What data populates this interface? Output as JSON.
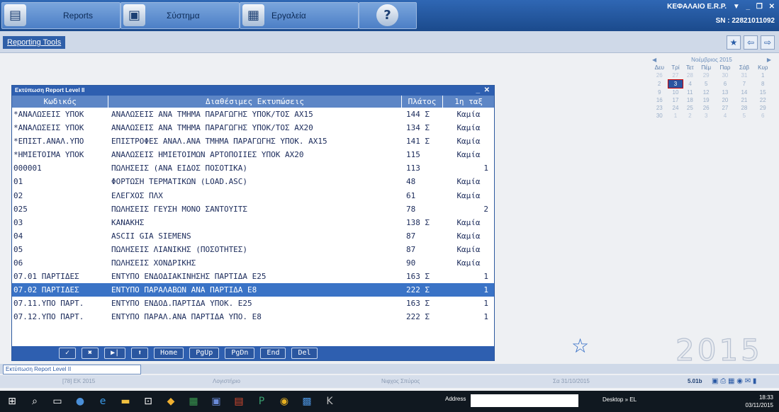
{
  "topbar": {
    "buttons": [
      {
        "label": "Reports",
        "icon": "reports-icon"
      },
      {
        "label": "Σύστημα",
        "icon": "system-icon"
      },
      {
        "label": "Εργαλεία",
        "icon": "tools-icon"
      },
      {
        "label": "",
        "icon": "help-icon"
      }
    ],
    "company": "ΚΕΦΑΛΑΙΟ E.R.P.",
    "serial": "SN : 22821011092"
  },
  "subbar": {
    "tab_label": "Reporting Tools"
  },
  "calendar": {
    "month": "Νοέμβριος 2015",
    "weekdays": [
      "Δευ",
      "Τρί",
      "Τετ",
      "Πέμ",
      "Παρ",
      "Σάβ",
      "Κυρ"
    ],
    "weeks": [
      [
        "26",
        "27",
        "28",
        "29",
        "30",
        "31",
        "1"
      ],
      [
        "2",
        "3",
        "4",
        "5",
        "6",
        "7",
        "8"
      ],
      [
        "9",
        "10",
        "11",
        "12",
        "13",
        "14",
        "15"
      ],
      [
        "16",
        "17",
        "18",
        "19",
        "20",
        "21",
        "22"
      ],
      [
        "23",
        "24",
        "25",
        "26",
        "27",
        "28",
        "29"
      ],
      [
        "30",
        "1",
        "2",
        "3",
        "4",
        "5",
        "6"
      ]
    ],
    "selected": "3",
    "year_watermark": "2015"
  },
  "dialog": {
    "title": "Εκτύπωση Report Level II",
    "columns": [
      "Κωδικός",
      "Διαθέσιμες Εκτυπώσεις",
      "Πλάτος",
      "1η ταξ"
    ],
    "rows": [
      {
        "code": "*ΑΝΑΛΩΣΕΙΣ ΥΠΟΚ",
        "desc": "ΑΝΑΛΩΣΕΙΣ ΑΝΑ ΤΜΗΜΑ ΠΑΡΑΓΩΓΗΣ ΥΠΟΚ/ΤΟΣ ΑΧ15",
        "width": "144 Σ",
        "first": "Καμία"
      },
      {
        "code": "*ΑΝΑΛΩΣΕΙΣ ΥΠΟΚ",
        "desc": "ΑΝΑΛΩΣΕΙΣ ΑΝΑ ΤΜΗΜΑ ΠΑΡΑΓΩΓΗΣ ΥΠΟΚ/ΤΟΣ ΑΧ20",
        "width": "134 Σ",
        "first": "Καμία"
      },
      {
        "code": "*ΕΠΙΣΤ.ΑΝΑΛ.ΥΠΟ",
        "desc": "ΕΠΙΣΤΡΟΦΕΣ ΑΝΑΛ.ΑΝΑ ΤΜΗΜΑ ΠΑΡΑΓΩΓΗΣ ΥΠΟΚ. ΑΧ15",
        "width": "141 Σ",
        "first": "Καμία"
      },
      {
        "code": "*ΗΜΙΕΤΟΙΜΑ ΥΠΟΚ",
        "desc": "ΑΝΑΛΩΣΕΙΣ ΗΜΙΕΤΟΙΜΩΝ ΑΡΤΟΠΟΙΙΕΣ ΥΠΟΚ ΑΧ20",
        "width": "115",
        "first": "Καμία"
      },
      {
        "code": "000001",
        "desc": "ΠΩΛΗΣΕΙΣ (ΑΝΑ ΕΙΔΟΣ ΠΟΣΟΤΙΚΑ)",
        "width": "113",
        "first": "1"
      },
      {
        "code": "01",
        "desc": "ΦΟΡΤΩΣΗ ΤΕΡΜΑΤΙΚΩΝ (LOAD.ASC)",
        "width": "48",
        "first": "Καμία"
      },
      {
        "code": "02",
        "desc": "ΕΛΕΓΧΟΣ ΠΛΧ",
        "width": "61",
        "first": "Καμία"
      },
      {
        "code": "025",
        "desc": "ΠΩΛΗΣΕΙΣ ΓΕΥΣΗ ΜΟΝΟ ΣΑΝΤΟΥΙΤΣ",
        "width": "78",
        "first": "2"
      },
      {
        "code": "03",
        "desc": "ΚΑΝΑΚΗΣ",
        "width": "138 Σ",
        "first": "Καμία"
      },
      {
        "code": "04",
        "desc": "ASCII GIA SIEMENS",
        "width": "87",
        "first": "Καμία"
      },
      {
        "code": "05",
        "desc": "ΠΩΛΗΣΕΙΣ ΛΙΑΝΙΚΗΣ (ΠΟΣΟΤΗΤΕΣ)",
        "width": "87",
        "first": "Καμία"
      },
      {
        "code": "06",
        "desc": "ΠΩΛΗΣΕΙΣ ΧΟΝΔΡΙΚΗΣ",
        "width": "90",
        "first": "Καμία"
      },
      {
        "code": "07.01 ΠΑΡΤΙΔΕΣ",
        "desc": "ΕΝΤΥΠΟ ΕΝΔΟΔΙΑΚΙΝΗΣΗΣ ΠΑΡΤΙΔΑ Ε25",
        "width": "163 Σ",
        "first": "1"
      },
      {
        "code": "07.02 ΠΑΡΤΙΔΕΣ",
        "desc": "ΕΝΤΥΠΟ ΠΑΡΑΛΑΒΩΝ ΑΝΑ ΠΑΡΤΙΔΑ Ε8",
        "width": "222 Σ",
        "first": "1"
      },
      {
        "code": "07.11.ΥΠΟ ΠΑΡΤ.",
        "desc": "ΕΝΤΥΠΟ ΕΝΔΟΔ.ΠΑΡΤΙΔΑ ΥΠΟΚ. Ε25",
        "width": "163 Σ",
        "first": "1"
      },
      {
        "code": "07.12.ΥΠΟ ΠΑΡΤ.",
        "desc": "ΕΝΤΥΠΟ ΠΑΡΑΛ.ΑΝΑ ΠΑΡΤΙΔΑ ΥΠΟ. Ε8",
        "width": "222 Σ",
        "first": "1"
      }
    ],
    "selected_index": 13,
    "footer_keys": [
      "✓",
      "✖",
      "▶|",
      "⬆",
      "Home",
      "PgUp",
      "PgDn",
      "End",
      "Del"
    ]
  },
  "status": {
    "tab_label": "Εκτύπωση Report Level II",
    "info": [
      "[78] ΕΚ 2015",
      "Λογιστήριο",
      "Νιφχος Σπύρος",
      "Σα 31/10/2015"
    ],
    "version": "5.01b"
  },
  "taskbar": {
    "address_label": "Address",
    "tray_text": "Desktop » EL",
    "time": "18:33",
    "date": "03/11/2015"
  }
}
